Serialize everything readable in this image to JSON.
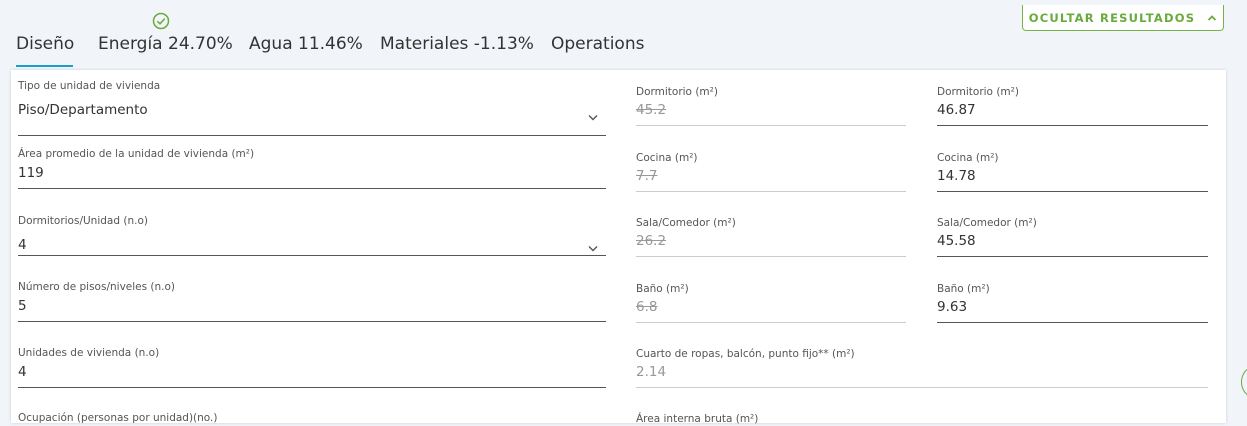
{
  "tabs": [
    {
      "label": "Diseño"
    },
    {
      "label": "Energía 24.70%"
    },
    {
      "label": "Agua 11.46%"
    },
    {
      "label": "Materiales -1.13%"
    },
    {
      "label": "Operations"
    }
  ],
  "hide_results_label": "OCULTAR RESULTADOS",
  "accent_color": "#1aa0c8",
  "success_color": "#6aaa3c",
  "left_fields": [
    {
      "label": "Tipo de unidad de vivienda",
      "value": "Piso/Departamento",
      "dropdown": true
    },
    {
      "label": "Área promedio de la unidad de vivienda (m²)",
      "value": "119"
    },
    {
      "label": "Dormitorios/Unidad (n.o)",
      "value": "4",
      "dropdown": true
    },
    {
      "label": "Número de pisos/niveles (n.o)",
      "value": "5"
    },
    {
      "label": "Unidades de vivienda (n.o)",
      "value": "4"
    },
    {
      "label": "Ocupación (personas por unidad)(no.)",
      "value": ""
    }
  ],
  "default_fields": [
    {
      "label": "Dormitorio (m²)",
      "value": "45.2"
    },
    {
      "label": "Cocina (m²)",
      "value": "7.7"
    },
    {
      "label": "Sala/Comedor (m²)",
      "value": "26.2"
    },
    {
      "label": "Baño (m²)",
      "value": "6.8"
    },
    {
      "label": "Cuarto de ropas, balcón, punto fijo** (m²)",
      "value": "2.14"
    },
    {
      "label": "Área interna bruta (m²)",
      "value": ""
    }
  ],
  "edited_fields": [
    {
      "label": "Dormitorio (m²)",
      "value": "46.87"
    },
    {
      "label": "Cocina (m²)",
      "value": "14.78"
    },
    {
      "label": "Sala/Comedor (m²)",
      "value": "45.58"
    },
    {
      "label": "Baño (m²)",
      "value": "9.63"
    }
  ]
}
